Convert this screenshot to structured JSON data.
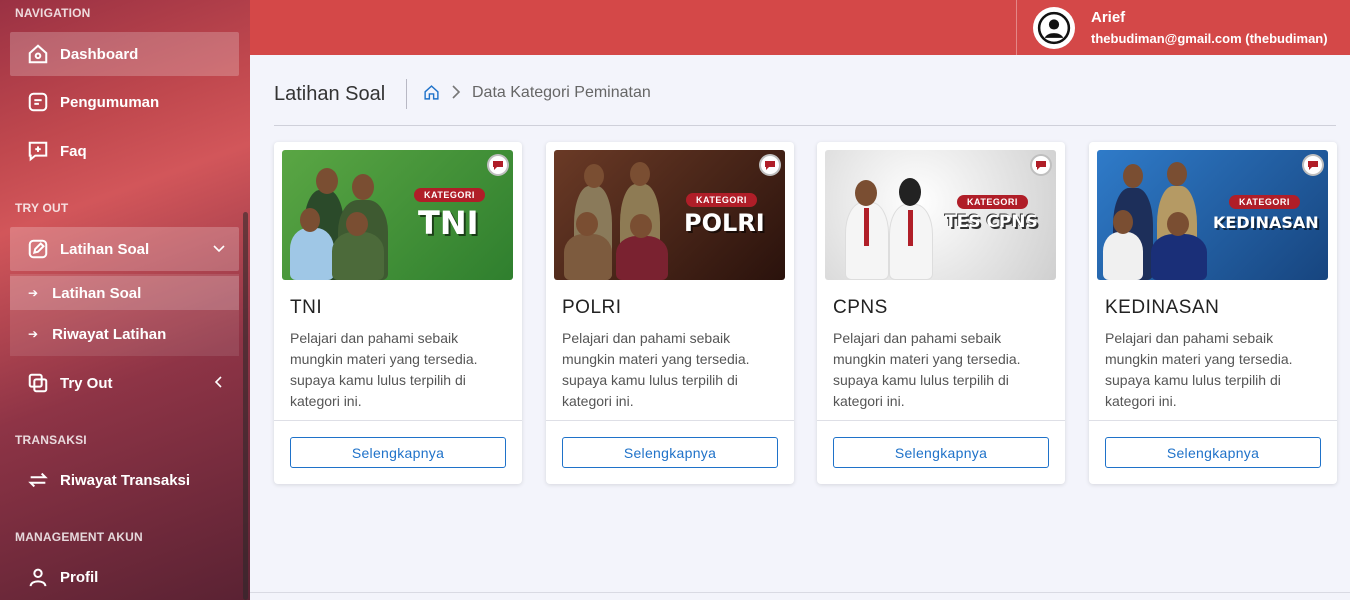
{
  "sidebar": {
    "sections": {
      "navigation": "NAVIGATION",
      "tryout": "TRY OUT",
      "transaksi": "TRANSAKSI",
      "akun": "MANAGEMENT AKUN"
    },
    "items": {
      "dashboard": "Dashboard",
      "pengumuman": "Pengumuman",
      "faq": "Faq",
      "latihan_soal": "Latihan Soal",
      "tryout": "Try Out",
      "riwayat_transaksi": "Riwayat Transaksi",
      "profil": "Profil"
    },
    "sub_items": {
      "latihan_soal": "Latihan Soal",
      "riwayat_latihan": "Riwayat Latihan"
    }
  },
  "header": {
    "user_name": "Arief",
    "user_email": "thebudiman@gmail.com (thebudiman)"
  },
  "breadcrumb": {
    "page_title": "Latihan Soal",
    "current": "Data Kategori Peminatan"
  },
  "cards": [
    {
      "title": "TNI",
      "banner_tag": "KATEGORI",
      "banner_text": "TNI",
      "description": "Pelajari dan pahami sebaik mungkin materi yang tersedia. supaya kamu lulus terpilih di kategori ini.",
      "button": "Selengkapnya",
      "banner_color": "#3f8f3a"
    },
    {
      "title": "POLRI",
      "banner_tag": "KATEGORI",
      "banner_text": "POLRI",
      "description": "Pelajari dan pahami sebaik mungkin materi yang tersedia. supaya kamu lulus terpilih di kategori ini.",
      "button": "Selengkapnya",
      "banner_color": "#4a2a1e"
    },
    {
      "title": "CPNS",
      "banner_tag": "KATEGORI",
      "banner_text": "TES CPNS",
      "description": "Pelajari dan pahami sebaik mungkin materi yang tersedia. supaya kamu lulus terpilih di kategori ini.",
      "button": "Selengkapnya",
      "banner_color": "#e6e6e6"
    },
    {
      "title": "KEDINASAN",
      "banner_tag": "KATEGORI",
      "banner_text": "KEDINASAN",
      "description": "Pelajari dan pahami sebaik mungkin materi yang tersedia. supaya kamu lulus terpilih di kategori ini.",
      "button": "Selengkapnya",
      "banner_color": "#1f63a8"
    }
  ],
  "colors": {
    "header": "#d44848",
    "accent_blue": "#1f72c9",
    "kategori_badge": "#b01e28"
  }
}
